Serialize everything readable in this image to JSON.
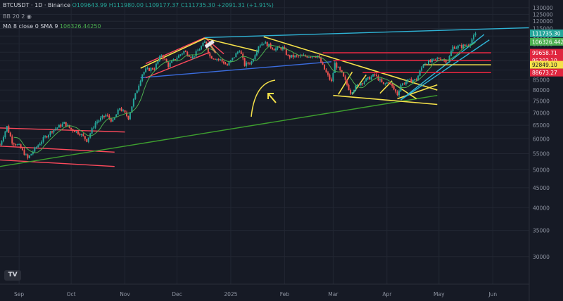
{
  "header": {
    "symbol": "BTCUSDT · 1D · Binance",
    "open": "O109643.99",
    "high": "H111980.00",
    "low": "L109177.37",
    "close": "C111735.30",
    "change": "+2091.31 (+1.91%)",
    "bb_label": "BB 20 2",
    "ma_label": "MA 8 close 0 SMA 9",
    "ma_value": "106326.44250"
  },
  "logo_text": "TV",
  "colors": {
    "bg": "#161a25",
    "grid": "#222733",
    "up": "#26a69a",
    "down": "#ef5350",
    "axis_text": "#8d93a0",
    "yellow": "#f5e14a",
    "red": "#ff4a5c",
    "blue": "#3b6de0",
    "cyan": "#2fb4d6",
    "green": "#3e9f2f",
    "crimson": "#e0263f",
    "ma": "#4caf50"
  },
  "chart_data": {
    "type": "candlestick",
    "y_scale": "log",
    "ylim": [
      25500,
      136000
    ],
    "x_range": [
      "2024-08-21",
      "2025-06-22"
    ],
    "y_ticks": [
      130000,
      125000,
      120000,
      115000,
      110000,
      105000,
      100000,
      95000,
      90000,
      85000,
      80000,
      75000,
      70000,
      65000,
      60000,
      55000,
      50000,
      45000,
      40000,
      35000,
      30000
    ],
    "x_ticks": [
      {
        "date": "2024-09-01",
        "label": "Sep"
      },
      {
        "date": "2024-10-01",
        "label": "Oct"
      },
      {
        "date": "2024-11-01",
        "label": "Nov"
      },
      {
        "date": "2024-12-01",
        "label": "Dec"
      },
      {
        "date": "2025-01-01",
        "label": "2025"
      },
      {
        "date": "2025-02-01",
        "label": "Feb"
      },
      {
        "date": "2025-03-01",
        "label": "Mar"
      },
      {
        "date": "2025-04-01",
        "label": "Apr"
      },
      {
        "date": "2025-05-01",
        "label": "May"
      },
      {
        "date": "2025-06-01",
        "label": "Jun"
      }
    ],
    "price_path": [
      [
        "2024-08-21",
        58000
      ],
      [
        "2024-08-25",
        64500
      ],
      [
        "2024-08-28",
        59000
      ],
      [
        "2024-09-01",
        57500
      ],
      [
        "2024-09-06",
        53500
      ],
      [
        "2024-09-10",
        56500
      ],
      [
        "2024-09-15",
        60000
      ],
      [
        "2024-09-20",
        63000
      ],
      [
        "2024-09-27",
        65800
      ],
      [
        "2024-10-01",
        63500
      ],
      [
        "2024-10-06",
        62000
      ],
      [
        "2024-10-10",
        59500
      ],
      [
        "2024-10-15",
        66000
      ],
      [
        "2024-10-21",
        69000
      ],
      [
        "2024-10-25",
        66500
      ],
      [
        "2024-10-29",
        72000
      ],
      [
        "2024-11-03",
        68000
      ],
      [
        "2024-11-06",
        75500
      ],
      [
        "2024-11-11",
        88000
      ],
      [
        "2024-11-13",
        90000
      ],
      [
        "2024-11-18",
        91000
      ],
      [
        "2024-11-22",
        98500
      ],
      [
        "2024-11-26",
        92500
      ],
      [
        "2024-12-01",
        97000
      ],
      [
        "2024-12-05",
        100500
      ],
      [
        "2024-12-10",
        97000
      ],
      [
        "2024-12-17",
        106000
      ],
      [
        "2024-12-20",
        97500
      ],
      [
        "2024-12-26",
        95500
      ],
      [
        "2024-12-30",
        92500
      ],
      [
        "2025-01-06",
        101500
      ],
      [
        "2025-01-09",
        92800
      ],
      [
        "2025-01-13",
        94500
      ],
      [
        "2025-01-17",
        104000
      ],
      [
        "2025-01-20",
        106000
      ],
      [
        "2025-01-26",
        102000
      ],
      [
        "2025-01-31",
        102500
      ],
      [
        "2025-02-03",
        97500
      ],
      [
        "2025-02-10",
        97500
      ],
      [
        "2025-02-20",
        98000
      ],
      [
        "2025-02-25",
        88500
      ],
      [
        "2025-02-28",
        84000
      ],
      [
        "2025-03-02",
        93500
      ],
      [
        "2025-03-06",
        88000
      ],
      [
        "2025-03-11",
        79000
      ],
      [
        "2025-03-16",
        83000
      ],
      [
        "2025-03-25",
        87500
      ],
      [
        "2025-03-30",
        82500
      ],
      [
        "2025-04-02",
        84000
      ],
      [
        "2025-04-07",
        78000
      ],
      [
        "2025-04-09",
        82500
      ],
      [
        "2025-04-13",
        84500
      ],
      [
        "2025-04-18",
        85000
      ],
      [
        "2025-04-22",
        93500
      ],
      [
        "2025-04-26",
        94500
      ],
      [
        "2025-05-01",
        96500
      ],
      [
        "2025-05-06",
        94700
      ],
      [
        "2025-05-09",
        103000
      ],
      [
        "2025-05-14",
        103500
      ],
      [
        "2025-05-18",
        104500
      ],
      [
        "2025-05-21",
        109500
      ],
      [
        "2025-05-22",
        111735
      ]
    ],
    "horizontal_levels": [
      {
        "price": 99658.71,
        "label": "99658.71",
        "color": "red"
      },
      {
        "price": 95303.1,
        "label": "95303.10",
        "color": "red"
      },
      {
        "price": 92849.1,
        "label": "92849.10",
        "color": "yellow"
      },
      {
        "price": 88673.27,
        "label": "88673.27",
        "color": "red"
      }
    ],
    "price_tags": [
      {
        "price": 111735.3,
        "label": "111735.30",
        "color": "up"
      },
      {
        "price": 106326.44,
        "label": "106326.44250",
        "color": "ma"
      }
    ],
    "drawings": [
      {
        "color": "red",
        "points": [
          [
            "2024-08-21",
            64000
          ],
          [
            "2024-11-01",
            62500
          ]
        ]
      },
      {
        "color": "red",
        "points": [
          [
            "2024-08-21",
            57500
          ],
          [
            "2024-10-26",
            55500
          ]
        ]
      },
      {
        "color": "red",
        "points": [
          [
            "2024-08-21",
            53000
          ],
          [
            "2024-10-26",
            51000
          ]
        ]
      },
      {
        "color": "green",
        "points": [
          [
            "2024-08-21",
            51000
          ],
          [
            "2025-04-30",
            77500
          ]
        ]
      },
      {
        "color": "blue",
        "points": [
          [
            "2024-11-10",
            86000
          ],
          [
            "2025-02-28",
            94500
          ]
        ]
      },
      {
        "color": "red",
        "points": [
          [
            "2024-11-13",
            93500
          ],
          [
            "2024-12-17",
            109000
          ]
        ]
      },
      {
        "color": "red",
        "points": [
          [
            "2024-11-13",
            86000
          ],
          [
            "2024-12-20",
            100000
          ]
        ]
      },
      {
        "color": "red",
        "points": [
          [
            "2024-12-17",
            109000
          ],
          [
            "2024-12-28",
            99000
          ]
        ]
      },
      {
        "color": "yellow",
        "points": [
          [
            "2024-11-10",
            91000
          ],
          [
            "2024-12-17",
            108500
          ]
        ]
      },
      {
        "color": "yellow",
        "points": [
          [
            "2024-12-17",
            108500
          ],
          [
            "2025-01-17",
            100500
          ]
        ]
      },
      {
        "color": "yellow",
        "points": [
          [
            "2025-01-20",
            109500
          ],
          [
            "2025-04-30",
            80000
          ]
        ]
      },
      {
        "color": "yellow",
        "points": [
          [
            "2025-03-01",
            77500
          ],
          [
            "2025-04-30",
            73500
          ]
        ]
      },
      {
        "color": "yellow",
        "points": [
          [
            "2025-03-04",
            78000
          ],
          [
            "2025-03-12",
            89000
          ]
        ]
      },
      {
        "color": "yellow",
        "points": [
          [
            "2025-03-12",
            78000
          ],
          [
            "2025-03-20",
            87500
          ]
        ]
      },
      {
        "color": "yellow",
        "points": [
          [
            "2025-03-28",
            78500
          ],
          [
            "2025-04-04",
            84500
          ]
        ]
      },
      {
        "color": "yellow",
        "points": [
          [
            "2025-04-04",
            83500
          ],
          [
            "2025-04-18",
            76000
          ]
        ]
      },
      {
        "color": "yellow",
        "points": [
          [
            "2025-04-07",
            76000
          ],
          [
            "2025-04-30",
            82500
          ]
        ]
      },
      {
        "color": "cyan",
        "points": [
          [
            "2024-12-17",
            109000
          ],
          [
            "2025-06-22",
            115500
          ]
        ]
      },
      {
        "color": "cyan",
        "points": [
          [
            "2025-04-09",
            75500
          ],
          [
            "2025-05-27",
            111000
          ]
        ]
      },
      {
        "color": "cyan",
        "points": [
          [
            "2025-04-09",
            75500
          ],
          [
            "2025-05-30",
            107500
          ]
        ]
      },
      {
        "color": "crimson",
        "points": [
          [
            "2025-02-23",
            99658.71
          ],
          [
            "2025-05-31",
            99658.71
          ]
        ]
      },
      {
        "color": "crimson",
        "points": [
          [
            "2025-03-01",
            95303.1
          ],
          [
            "2025-05-31",
            95303.1
          ]
        ]
      },
      {
        "color": "yellow",
        "points": [
          [
            "2025-04-22",
            92849.1
          ],
          [
            "2025-05-31",
            92849.1
          ]
        ]
      },
      {
        "color": "crimson",
        "points": [
          [
            "2025-03-18",
            88673.27
          ],
          [
            "2025-05-31",
            88673.27
          ]
        ]
      }
    ]
  }
}
